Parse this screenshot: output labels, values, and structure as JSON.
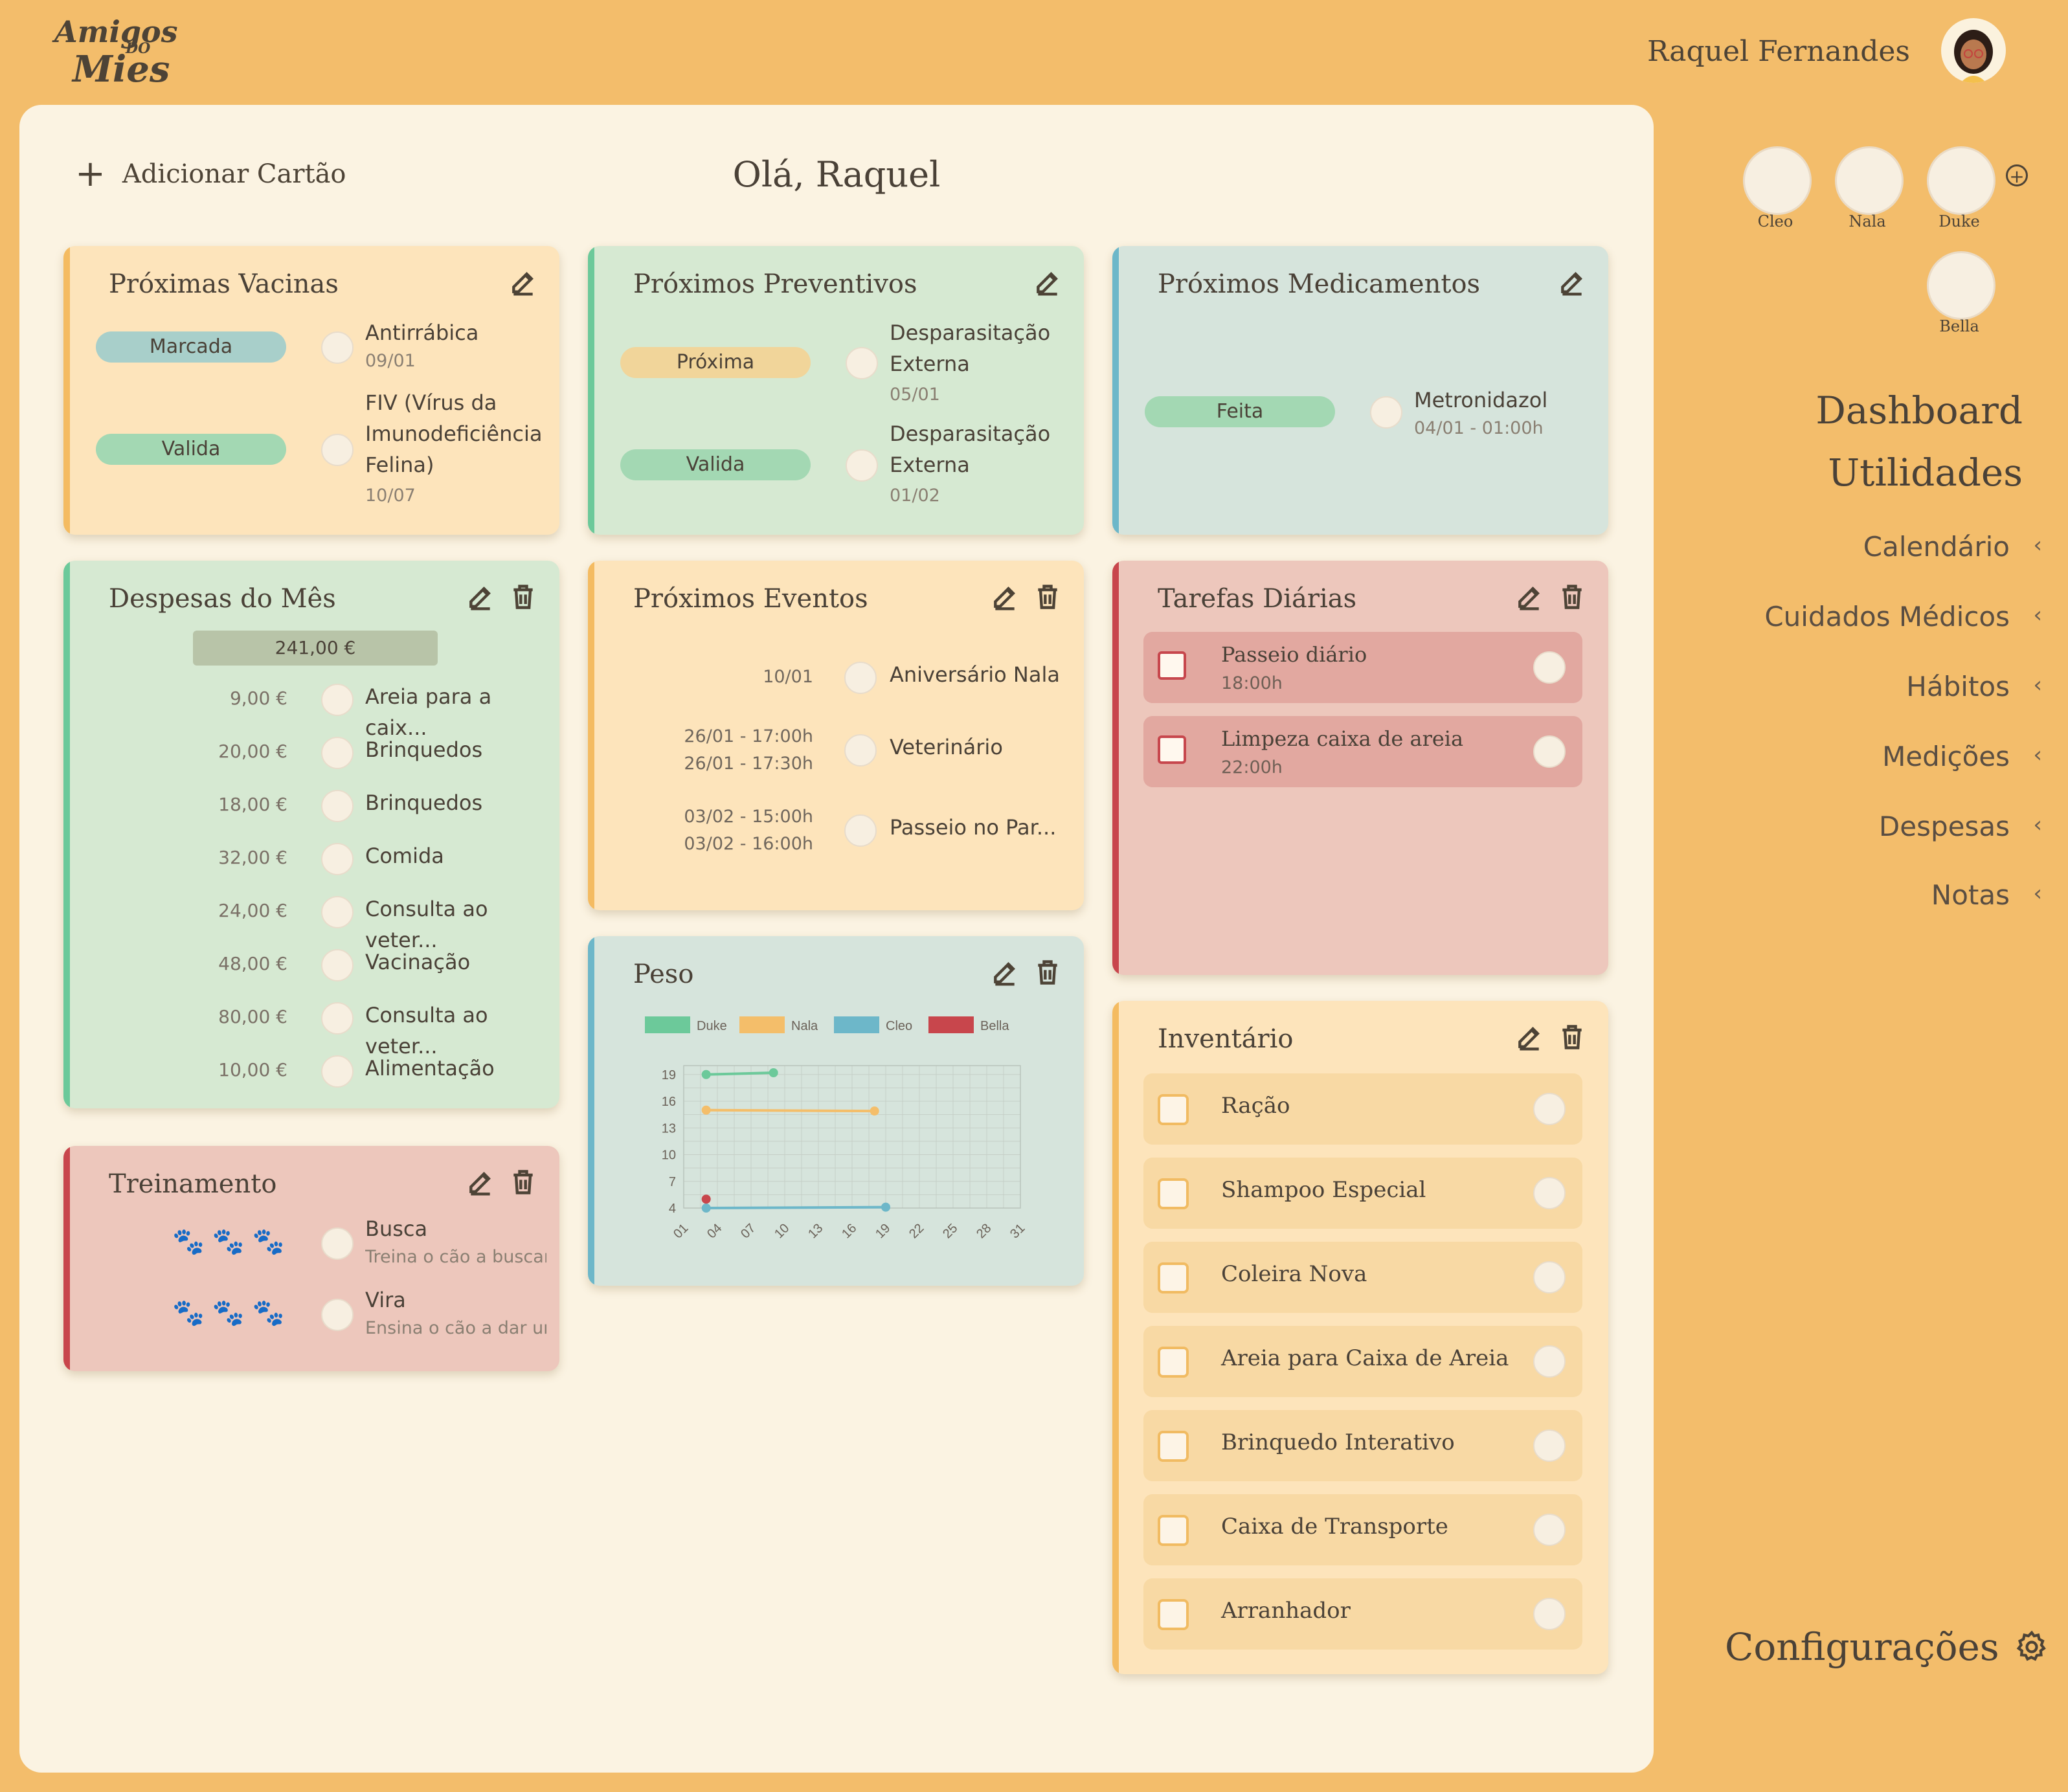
{
  "app": {
    "logo": {
      "line1": "Amigos",
      "line2": "DO",
      "line3": "Mies"
    },
    "user_name": "Raquel Fernandes",
    "greeting": "Olá, Raquel",
    "add_card_label": "Adicionar Cartão"
  },
  "pets": [
    {
      "name": "Cleo",
      "icon": "cat-cleo-icon"
    },
    {
      "name": "Nala",
      "icon": "dog-nala-icon"
    },
    {
      "name": "Duke",
      "icon": "dog-duke-icon"
    },
    {
      "name": "Bella",
      "icon": "cat-bella-icon"
    }
  ],
  "sidebar": {
    "dashboard": "Dashboard",
    "utilidades": "Utilidades",
    "items": [
      {
        "label": "Calendário"
      },
      {
        "label": "Cuidados Médicos"
      },
      {
        "label": "Hábitos"
      },
      {
        "label": "Medições"
      },
      {
        "label": "Despesas"
      },
      {
        "label": "Notas"
      }
    ],
    "settings": "Configurações"
  },
  "vacinas": {
    "title": "Próximas Vacinas",
    "items": [
      {
        "status": "Marcada",
        "name": "Antirrábica",
        "date": "09/01"
      },
      {
        "status": "Valida",
        "name_lines": [
          "FIV (Vírus da",
          "Imunodeficiência",
          "Felina)"
        ],
        "date": "10/07"
      }
    ]
  },
  "preventivos": {
    "title": "Próximos Preventivos",
    "items": [
      {
        "status": "Próxima",
        "name_lines": [
          "Desparasitação",
          "Externa"
        ],
        "date": "05/01"
      },
      {
        "status": "Valida",
        "name_lines": [
          "Desparasitação",
          "Externa"
        ],
        "date": "01/02"
      }
    ]
  },
  "medicamentos": {
    "title": "Próximos Medicamentos",
    "items": [
      {
        "status": "Feita",
        "name": "Metronidazol",
        "date": "04/01 - 01:00h"
      }
    ]
  },
  "despesas": {
    "title": "Despesas do Mês",
    "total": "241,00 €",
    "items": [
      {
        "value": "9,00 €",
        "label": "Areia para a caix..."
      },
      {
        "value": "20,00 €",
        "label": "Brinquedos"
      },
      {
        "value": "18,00 €",
        "label": "Brinquedos"
      },
      {
        "value": "32,00 €",
        "label": "Comida"
      },
      {
        "value": "24,00 €",
        "label": "Consulta ao veter..."
      },
      {
        "value": "48,00 €",
        "label": "Vacinação"
      },
      {
        "value": "80,00 €",
        "label": "Consulta ao veter..."
      },
      {
        "value": "10,00 €",
        "label": "Alimentação"
      }
    ]
  },
  "eventos": {
    "title": "Próximos Eventos",
    "items": [
      {
        "when": [
          "10/01"
        ],
        "label": "Aniversário Nala"
      },
      {
        "when": [
          "26/01 - 17:00h",
          "26/01 - 17:30h"
        ],
        "label": "Veterinário"
      },
      {
        "when": [
          "03/02 - 15:00h",
          "03/02 - 16:00h"
        ],
        "label": "Passeio no Par..."
      }
    ]
  },
  "tarefas": {
    "title": "Tarefas Diárias",
    "items": [
      {
        "label": "Passeio diário",
        "time": "18:00h"
      },
      {
        "label": "Limpeza caixa de areia",
        "time": "22:00h"
      }
    ]
  },
  "peso": {
    "title": "Peso"
  },
  "treinamento": {
    "title": "Treinamento",
    "items": [
      {
        "name": "Busca",
        "desc": "Treina o cão a buscar"
      },
      {
        "name": "Vira",
        "desc": "Ensina o cão a dar um"
      }
    ]
  },
  "inventario": {
    "title": "Inventário",
    "items": [
      {
        "label": "Ração"
      },
      {
        "label": "Shampoo Especial"
      },
      {
        "label": "Coleira Nova"
      },
      {
        "label": "Areia para Caixa de Areia"
      },
      {
        "label": "Brinquedo Interativo"
      },
      {
        "label": "Caixa de Transporte"
      },
      {
        "label": "Arranhador"
      }
    ]
  },
  "colors": {
    "duke": "#6cc99a",
    "nala": "#f4be6a",
    "cleo": "#6db7c9",
    "bella": "#c8464c"
  },
  "chart_data": {
    "type": "line",
    "title": "",
    "x_ticks": [
      "01",
      "04",
      "07",
      "10",
      "13",
      "16",
      "19",
      "22",
      "25",
      "28",
      "31"
    ],
    "y_ticks": [
      4,
      7,
      10,
      13,
      16,
      19
    ],
    "ylim": [
      4,
      20
    ],
    "xlim": [
      1,
      31
    ],
    "legend": [
      "Duke",
      "Nala",
      "Cleo",
      "Bella"
    ],
    "legend_position": "top",
    "grid": true,
    "series": [
      {
        "name": "Duke",
        "color": "#6cc99a",
        "points": [
          [
            3,
            19
          ],
          [
            9,
            19.2
          ]
        ]
      },
      {
        "name": "Nala",
        "color": "#f4be6a",
        "points": [
          [
            3,
            15
          ],
          [
            18,
            14.9
          ]
        ]
      },
      {
        "name": "Cleo",
        "color": "#6db7c9",
        "points": [
          [
            3,
            4
          ],
          [
            19,
            4.1
          ]
        ]
      },
      {
        "name": "Bella",
        "color": "#c8464c",
        "points": [
          [
            3,
            5
          ]
        ]
      }
    ]
  }
}
